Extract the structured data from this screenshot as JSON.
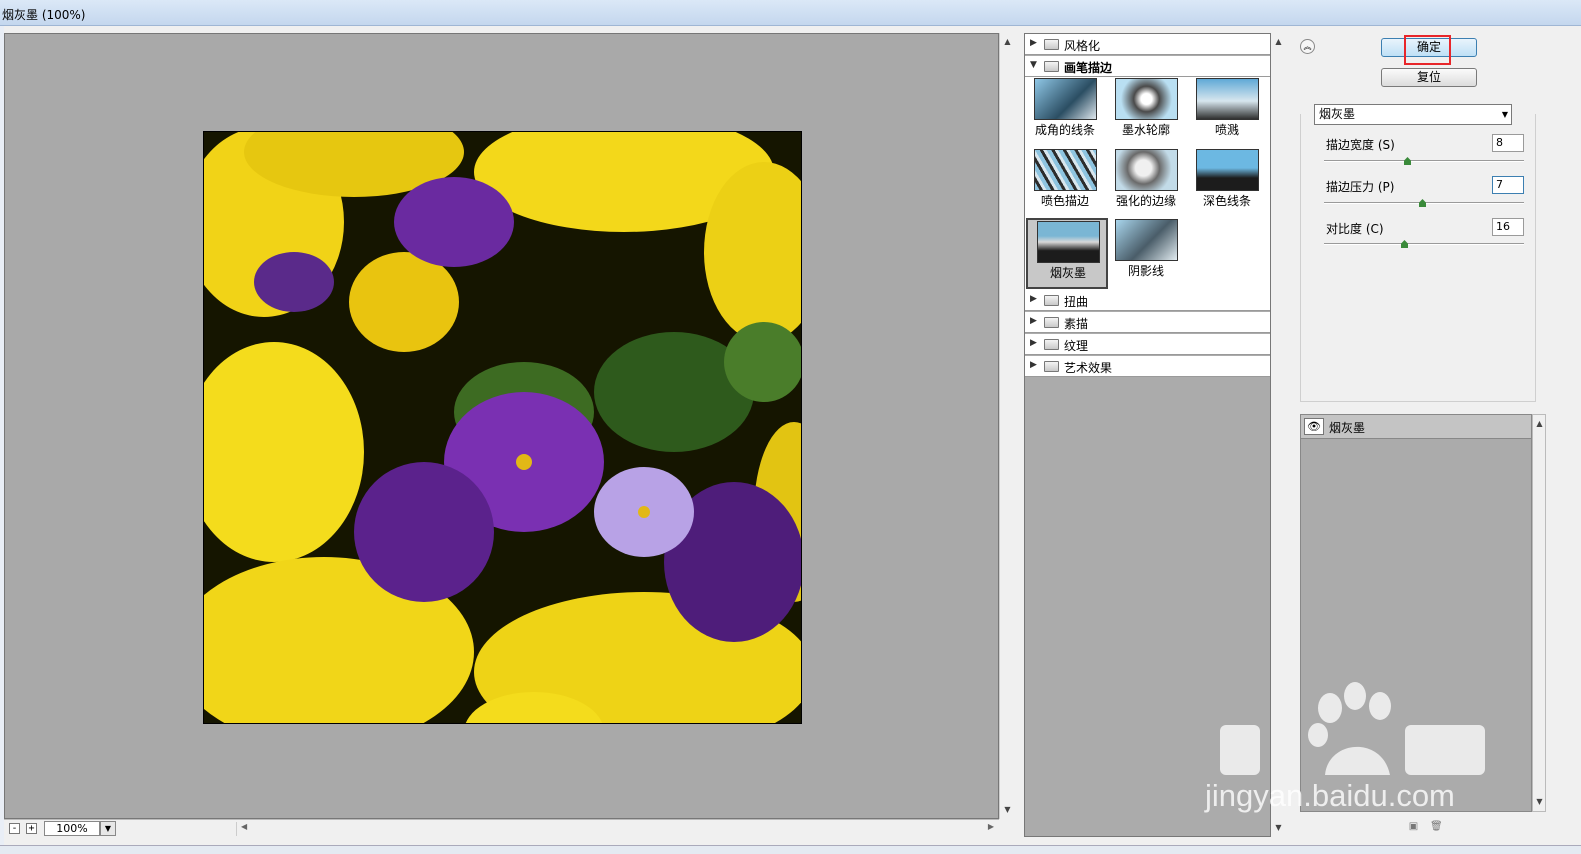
{
  "window": {
    "title": "烟灰墨 (100%)"
  },
  "preview": {
    "zoom": "100%",
    "zoom_out_label": "-",
    "zoom_in_label": "+"
  },
  "gallery": {
    "categories_top": [
      {
        "label": "风格化",
        "expanded": false
      },
      {
        "label": "画笔描边",
        "expanded": true
      }
    ],
    "filters": [
      {
        "label": "成角的线条"
      },
      {
        "label": "墨水轮廓"
      },
      {
        "label": "喷溅"
      },
      {
        "label": "喷色描边"
      },
      {
        "label": "强化的边缘"
      },
      {
        "label": "深色线条"
      },
      {
        "label": "烟灰墨",
        "selected": true
      },
      {
        "label": "阴影线"
      }
    ],
    "categories_bottom": [
      {
        "label": "扭曲"
      },
      {
        "label": "素描"
      },
      {
        "label": "纹理"
      },
      {
        "label": "艺术效果"
      }
    ]
  },
  "buttons": {
    "ok": "确定",
    "reset": "复位"
  },
  "filter_select": {
    "value": "烟灰墨"
  },
  "params": [
    {
      "label": "描边宽度 (S)",
      "value": "8",
      "slider": 0.43
    },
    {
      "label": "描边压力 (P)",
      "value": "7",
      "slider": 0.5
    },
    {
      "label": "对比度 (C)",
      "value": "16",
      "slider": 0.42
    }
  ],
  "layers": [
    {
      "name": "烟灰墨",
      "visible": true
    }
  ],
  "watermark": {
    "text": "jingyan.baidu.com",
    "brand": "Baidu经验"
  },
  "colors": {
    "accent_highlight": "#e8262a",
    "ok_button": "#bfe0f6",
    "preview_bg": "#a9a9a9"
  }
}
